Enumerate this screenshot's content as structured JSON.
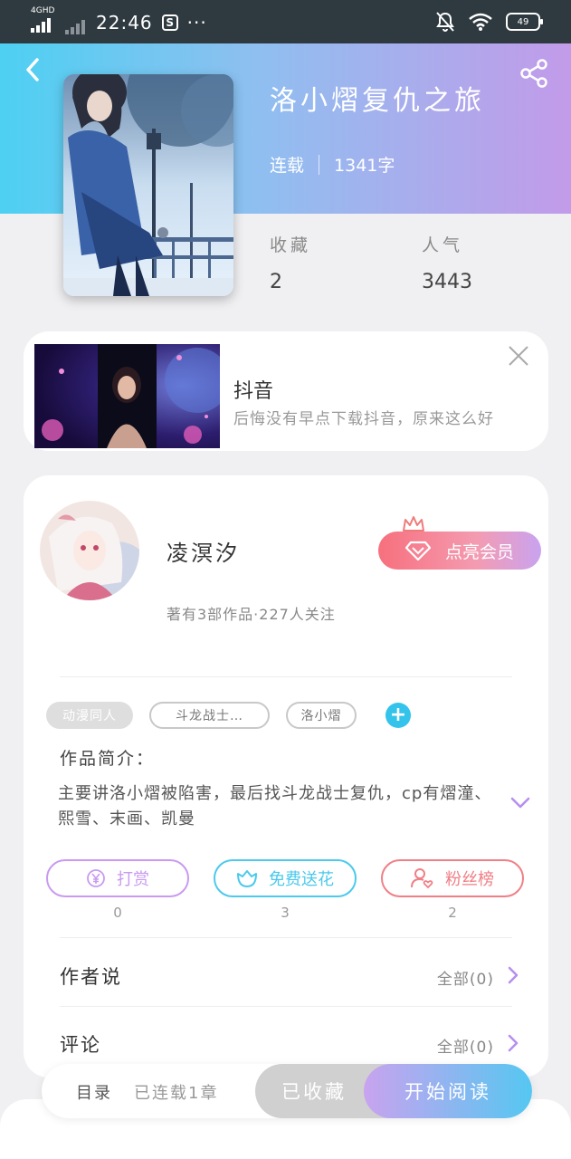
{
  "status_bar": {
    "network": "4GHD",
    "time": "22:46",
    "app_badge": "S",
    "more": "···",
    "battery": "49"
  },
  "header": {
    "back_icon": "back-arrow-icon",
    "share_icon": "share-icon",
    "gradient": [
      "#4dd0f2",
      "#c29be9"
    ]
  },
  "book": {
    "title": "洛小熠复仇之旅",
    "status": "连载",
    "word_count": "1341字",
    "stats": [
      {
        "label": "收藏",
        "value": "2"
      },
      {
        "label": "人气",
        "value": "3443"
      }
    ]
  },
  "ad": {
    "app_name": "抖音",
    "description": "后悔没有早点下载抖音，原来这么好",
    "close_icon": "close-icon"
  },
  "author": {
    "name": "凌溟汐",
    "subtitle": "著有3部作品·227人关注",
    "vip_button": "点亮会员"
  },
  "tags": [
    "动漫同人",
    "斗龙战士…",
    "洛小熠"
  ],
  "intro": {
    "title": "作品简介：",
    "text": "主要讲洛小熠被陷害，最后找斗龙战士复仇，cp有熠潼、熙雪、末画、凯曼"
  },
  "actions": [
    {
      "label": "打赏",
      "count": "0",
      "color": "#c99af0",
      "icon": "yen-icon"
    },
    {
      "label": "免费送花",
      "count": "3",
      "color": "#4cc9ec",
      "icon": "flower-icon"
    },
    {
      "label": "粉丝榜",
      "count": "2",
      "color": "#f07f86",
      "icon": "fan-rank-icon"
    }
  ],
  "rows": [
    {
      "title": "作者说",
      "value": "全部(0)"
    },
    {
      "title": "评论",
      "value": "全部(0)"
    }
  ],
  "bottom": {
    "toc_label": "目录",
    "toc_status": "已连载1章",
    "favorite_label": "已收藏",
    "read_label": "开始阅读"
  }
}
